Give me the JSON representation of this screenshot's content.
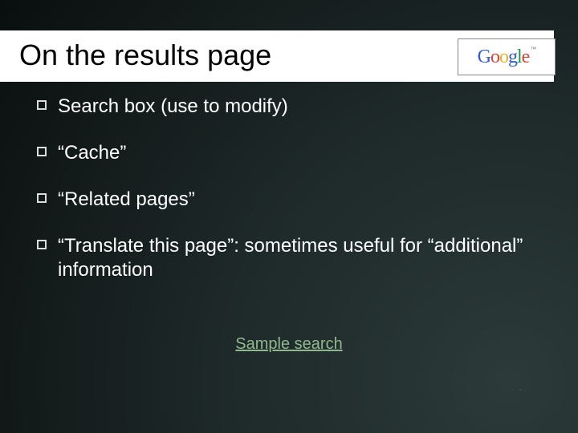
{
  "title": "On the results page",
  "logo": {
    "name": "Google",
    "trademark": "™"
  },
  "bullets": [
    "Search box (use to modify)",
    "“Cache”",
    "“Related pages”",
    "“Translate this page”: sometimes useful for “additional” information"
  ],
  "link": "Sample search"
}
